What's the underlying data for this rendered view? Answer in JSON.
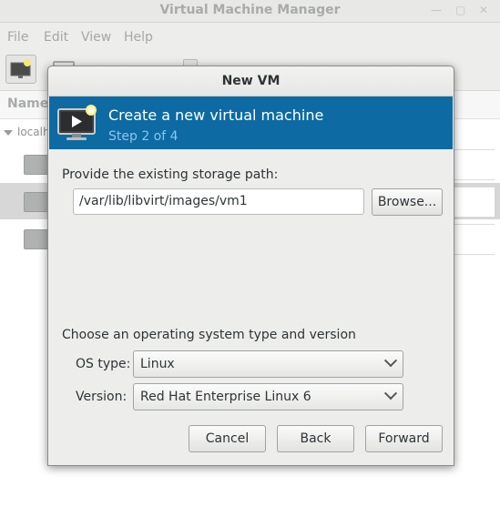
{
  "main_window": {
    "title": "Virtual Machine Manager",
    "menu": [
      "File",
      "Edit",
      "View",
      "Help"
    ],
    "column_name": "Name",
    "host": "localh"
  },
  "dialog": {
    "title": "New VM",
    "banner": {
      "title": "Create a new virtual machine",
      "step": "Step 2 of 4",
      "icon": "monitor-play-icon"
    },
    "storage_label": "Provide the existing storage path:",
    "storage_path": "/var/lib/libvirt/images/vm1",
    "browse_button": "Browse...",
    "os_section_label": "Choose an operating system type and version",
    "os_type_label": "OS type:",
    "os_type_value": "Linux",
    "version_label": "Version:",
    "version_value": "Red Hat Enterprise Linux 6",
    "buttons": {
      "cancel": "Cancel",
      "back": "Back",
      "forward": "Forward"
    }
  },
  "colors": {
    "banner": "#0d6aa3",
    "banner_step": "#8ec5ea"
  }
}
